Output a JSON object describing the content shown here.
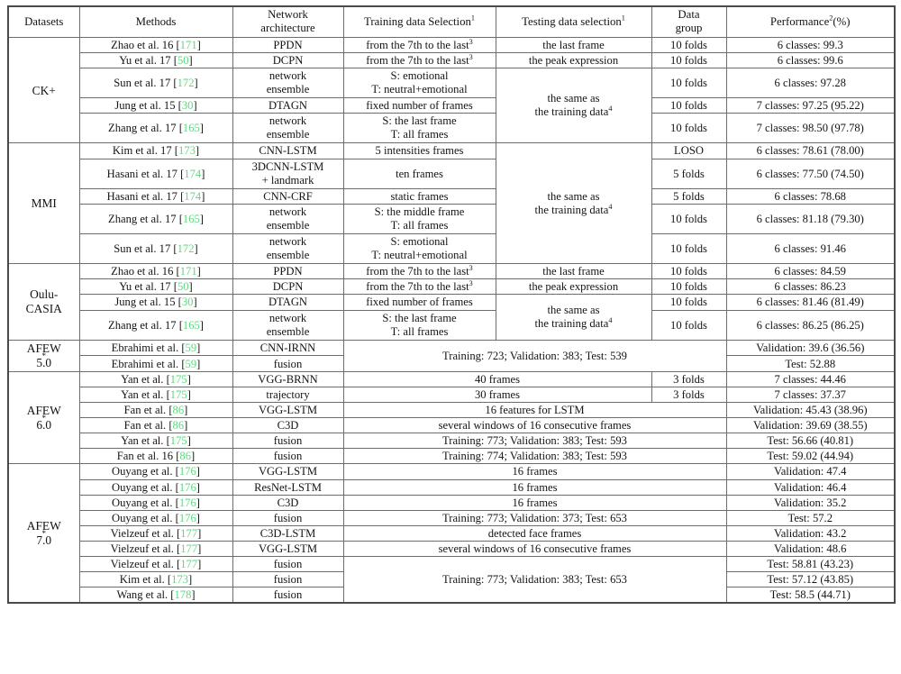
{
  "table": {
    "caption_present": false,
    "columns": [
      {
        "key": "datasets",
        "label": "Datasets"
      },
      {
        "key": "methods",
        "label": "Methods"
      },
      {
        "key": "network",
        "label": "Network architecture",
        "line1": "Network",
        "line2": "architecture"
      },
      {
        "key": "training",
        "label": "Training data Selection",
        "sup": "1"
      },
      {
        "key": "testing",
        "label": "Testing data selection",
        "sup": "1"
      },
      {
        "key": "group",
        "label": "Data group",
        "line1": "Data",
        "line2": "group"
      },
      {
        "key": "performance",
        "label": "Performance",
        "sup": "2",
        "suffix": "(%)"
      }
    ],
    "footnote_markers": {
      "training": "1",
      "testing": "1",
      "performance": "2",
      "seventh": "3",
      "training_data": "4"
    },
    "sections": [
      {
        "name": "CK+",
        "label": "CK+",
        "rows": [
          {
            "method": "Zhao et al. 16",
            "cite": "171",
            "network": "PPDN",
            "training": "from the 7th to the last",
            "training_sup": "3",
            "testing": "the last frame",
            "group": "10 folds",
            "performance": "6 classes: 99.3"
          },
          {
            "method": "Yu et al. 17",
            "cite": "50",
            "network": "DCPN",
            "training": "from the 7th to the last",
            "training_sup": "3",
            "testing": "the peak expression",
            "group": "10 folds",
            "performance": "6 classes: 99.6"
          },
          {
            "method": "Sun et al. 17",
            "cite": "172",
            "network_l1": "network",
            "network_l2": "ensemble",
            "training_l1": "S: emotional",
            "training_l2": "T: neutral+emotional",
            "testing_l1": "the same as",
            "testing_l2": "the training data",
            "testing_sup": "4",
            "group": "10 folds",
            "performance": "6 classes: 97.28"
          },
          {
            "method": "Jung et al. 15",
            "cite": "30",
            "network": "DTAGN",
            "training": "fixed number of frames",
            "group": "10 folds",
            "performance": "7 classes: 97.25 (95.22)"
          },
          {
            "method": "Zhang et al. 17",
            "cite": "165",
            "network_l1": "network",
            "network_l2": "ensemble",
            "training_l1": "S: the last frame",
            "training_l2": "T: all frames",
            "group": "10 folds",
            "performance": "7 classes: 98.50 (97.78)"
          }
        ]
      },
      {
        "name": "MMI",
        "label": "MMI",
        "rows": [
          {
            "method": "Kim et al. 17",
            "cite": "173",
            "network": "CNN-LSTM",
            "training": "5 intensities frames",
            "testing_l1": "the same as",
            "testing_l2": "the training data",
            "testing_sup": "4",
            "group": "LOSO",
            "performance": "6 classes: 78.61 (78.00)"
          },
          {
            "method": "Hasani et al. 17",
            "cite": "174",
            "network_l1": "3DCNN-LSTM",
            "network_l2": "+ landmark",
            "training": "ten frames",
            "group": "5 folds",
            "performance": "6 classes: 77.50 (74.50)"
          },
          {
            "method": "Hasani et al. 17",
            "cite": "174",
            "network": "CNN-CRF",
            "training": "static frames",
            "group": "5 folds",
            "performance": "6 classes: 78.68"
          },
          {
            "method": "Zhang et al. 17",
            "cite": "165",
            "network_l1": "network",
            "network_l2": "ensemble",
            "training_l1": "S: the middle frame",
            "training_l2": "T: all frames",
            "group": "10 folds",
            "performance": "6 classes: 81.18 (79.30)"
          },
          {
            "method": "Sun et al. 17",
            "cite": "172",
            "network_l1": "network",
            "network_l2": "ensemble",
            "training_l1": "S: emotional",
            "training_l2": "T: neutral+emotional",
            "group": "10 folds",
            "performance": "6 classes: 91.46"
          }
        ]
      },
      {
        "name": "Oulu-CASIA",
        "label_l1": "Oulu-",
        "label_l2": "CASIA",
        "rows": [
          {
            "method": "Zhao et al. 16",
            "cite": "171",
            "network": "PPDN",
            "training": "from the 7th to the last",
            "training_sup": "3",
            "testing": "the last frame",
            "group": "10 folds",
            "performance": "6 classes: 84.59"
          },
          {
            "method": "Yu et al. 17",
            "cite": "50",
            "network": "DCPN",
            "training": "from the 7th to the last",
            "training_sup": "3",
            "testing": "the peak expression",
            "group": "10 folds",
            "performance": "6 classes: 86.23"
          },
          {
            "method": "Jung et al. 15",
            "cite": "30",
            "network": "DTAGN",
            "training": "fixed number of frames",
            "testing_l1": "the same as",
            "testing_l2": "the training data",
            "testing_sup": "4",
            "group": "10 folds",
            "performance": "6 classes: 81.46 (81.49)"
          },
          {
            "method": "Zhang et al. 17",
            "cite": "165",
            "network_l1": "network",
            "network_l2": "ensemble",
            "training_l1": "S: the last frame",
            "training_l2": "T: all frames",
            "group": "10 folds",
            "performance": "6 classes: 86.25 (86.25)"
          }
        ]
      },
      {
        "name": "AFEW 5.0",
        "label_l1": "AFEW",
        "label_star": "*",
        "label_l2": "5.0",
        "shared_training": "Training: 723; Validation: 383; Test: 539",
        "rows": [
          {
            "method": "Ebrahimi et al.",
            "cite": "59",
            "network": "CNN-IRNN",
            "performance": "Validation: 39.6 (36.56)"
          },
          {
            "method": "Ebrahimi et al.",
            "cite": "59",
            "network": "fusion",
            "performance": "Test: 52.88"
          }
        ]
      },
      {
        "name": "AFEW 6.0",
        "label_l1": "AFEW",
        "label_star": "*",
        "label_l2": "6.0",
        "rows": [
          {
            "method": "Yan et al.",
            "cite": "175",
            "network": "VGG-BRNN",
            "training": "40 frames",
            "group": "3 folds",
            "performance": "7 classes: 44.46"
          },
          {
            "method": "Yan et al.",
            "cite": "175",
            "network": "trajectory",
            "training": "30 frames",
            "group": "3 folds",
            "performance": "7 classes: 37.37"
          },
          {
            "method": "Fan et al.",
            "cite": "86",
            "network": "VGG-LSTM",
            "training": "16 features for LSTM",
            "performance": "Validation: 45.43 (38.96)"
          },
          {
            "method": "Fan et al.",
            "cite": "86",
            "network": "C3D",
            "training": "several windows of 16 consecutive frames",
            "performance": "Validation: 39.69 (38.55)"
          },
          {
            "method": "Yan et al.",
            "cite": "175",
            "network": "fusion",
            "training": "Training: 773; Validation: 383; Test: 593",
            "performance": "Test: 56.66 (40.81)"
          },
          {
            "method": "Fan et al. 16",
            "cite": "86",
            "network": "fusion",
            "training": "Training: 774; Validation: 383; Test: 593",
            "performance": "Test: 59.02 (44.94)"
          }
        ]
      },
      {
        "name": "AFEW 7.0",
        "label_l1": "AFEW",
        "label_star": "*",
        "label_l2": "7.0",
        "shared_training_tail": "Training: 773; Validation: 383; Test: 653",
        "rows": [
          {
            "method": "Ouyang et al.",
            "cite": "176",
            "network": "VGG-LSTM",
            "training": "16 frames",
            "performance": "Validation: 47.4"
          },
          {
            "method": "Ouyang et al.",
            "cite": "176",
            "network": "ResNet-LSTM",
            "training": "16 frames",
            "performance": "Validation: 46.4"
          },
          {
            "method": "Ouyang et al.",
            "cite": "176",
            "network": "C3D",
            "training": "16 frames",
            "performance": "Validation: 35.2"
          },
          {
            "method": "Ouyang et al.",
            "cite": "176",
            "network": "fusion",
            "training": "Training: 773; Validation: 373; Test: 653",
            "performance": "Test: 57.2"
          },
          {
            "method": "Vielzeuf et al.",
            "cite": "177",
            "network": "C3D-LSTM",
            "training": "detected face frames",
            "performance": "Validation: 43.2"
          },
          {
            "method": "Vielzeuf et al.",
            "cite": "177",
            "network": "VGG-LSTM",
            "training": "several windows of 16 consecutive frames",
            "performance": "Validation: 48.6"
          },
          {
            "method": "Vielzeuf et al.",
            "cite": "177",
            "network": "fusion",
            "performance": "Test: 58.81 (43.23)"
          },
          {
            "method": "Kim et al.",
            "cite": "173",
            "network": "fusion",
            "performance": "Test: 57.12 (43.85)"
          },
          {
            "method": "Wang et al.",
            "cite": "178",
            "network": "fusion",
            "performance": "Test: 58.5 (44.71)"
          }
        ]
      }
    ]
  },
  "colors": {
    "citation_green": "#5fd87f",
    "border": "#6d6d6d",
    "border_strong": "#4a4a4a",
    "text": "#141414",
    "background": "#ffffff"
  }
}
